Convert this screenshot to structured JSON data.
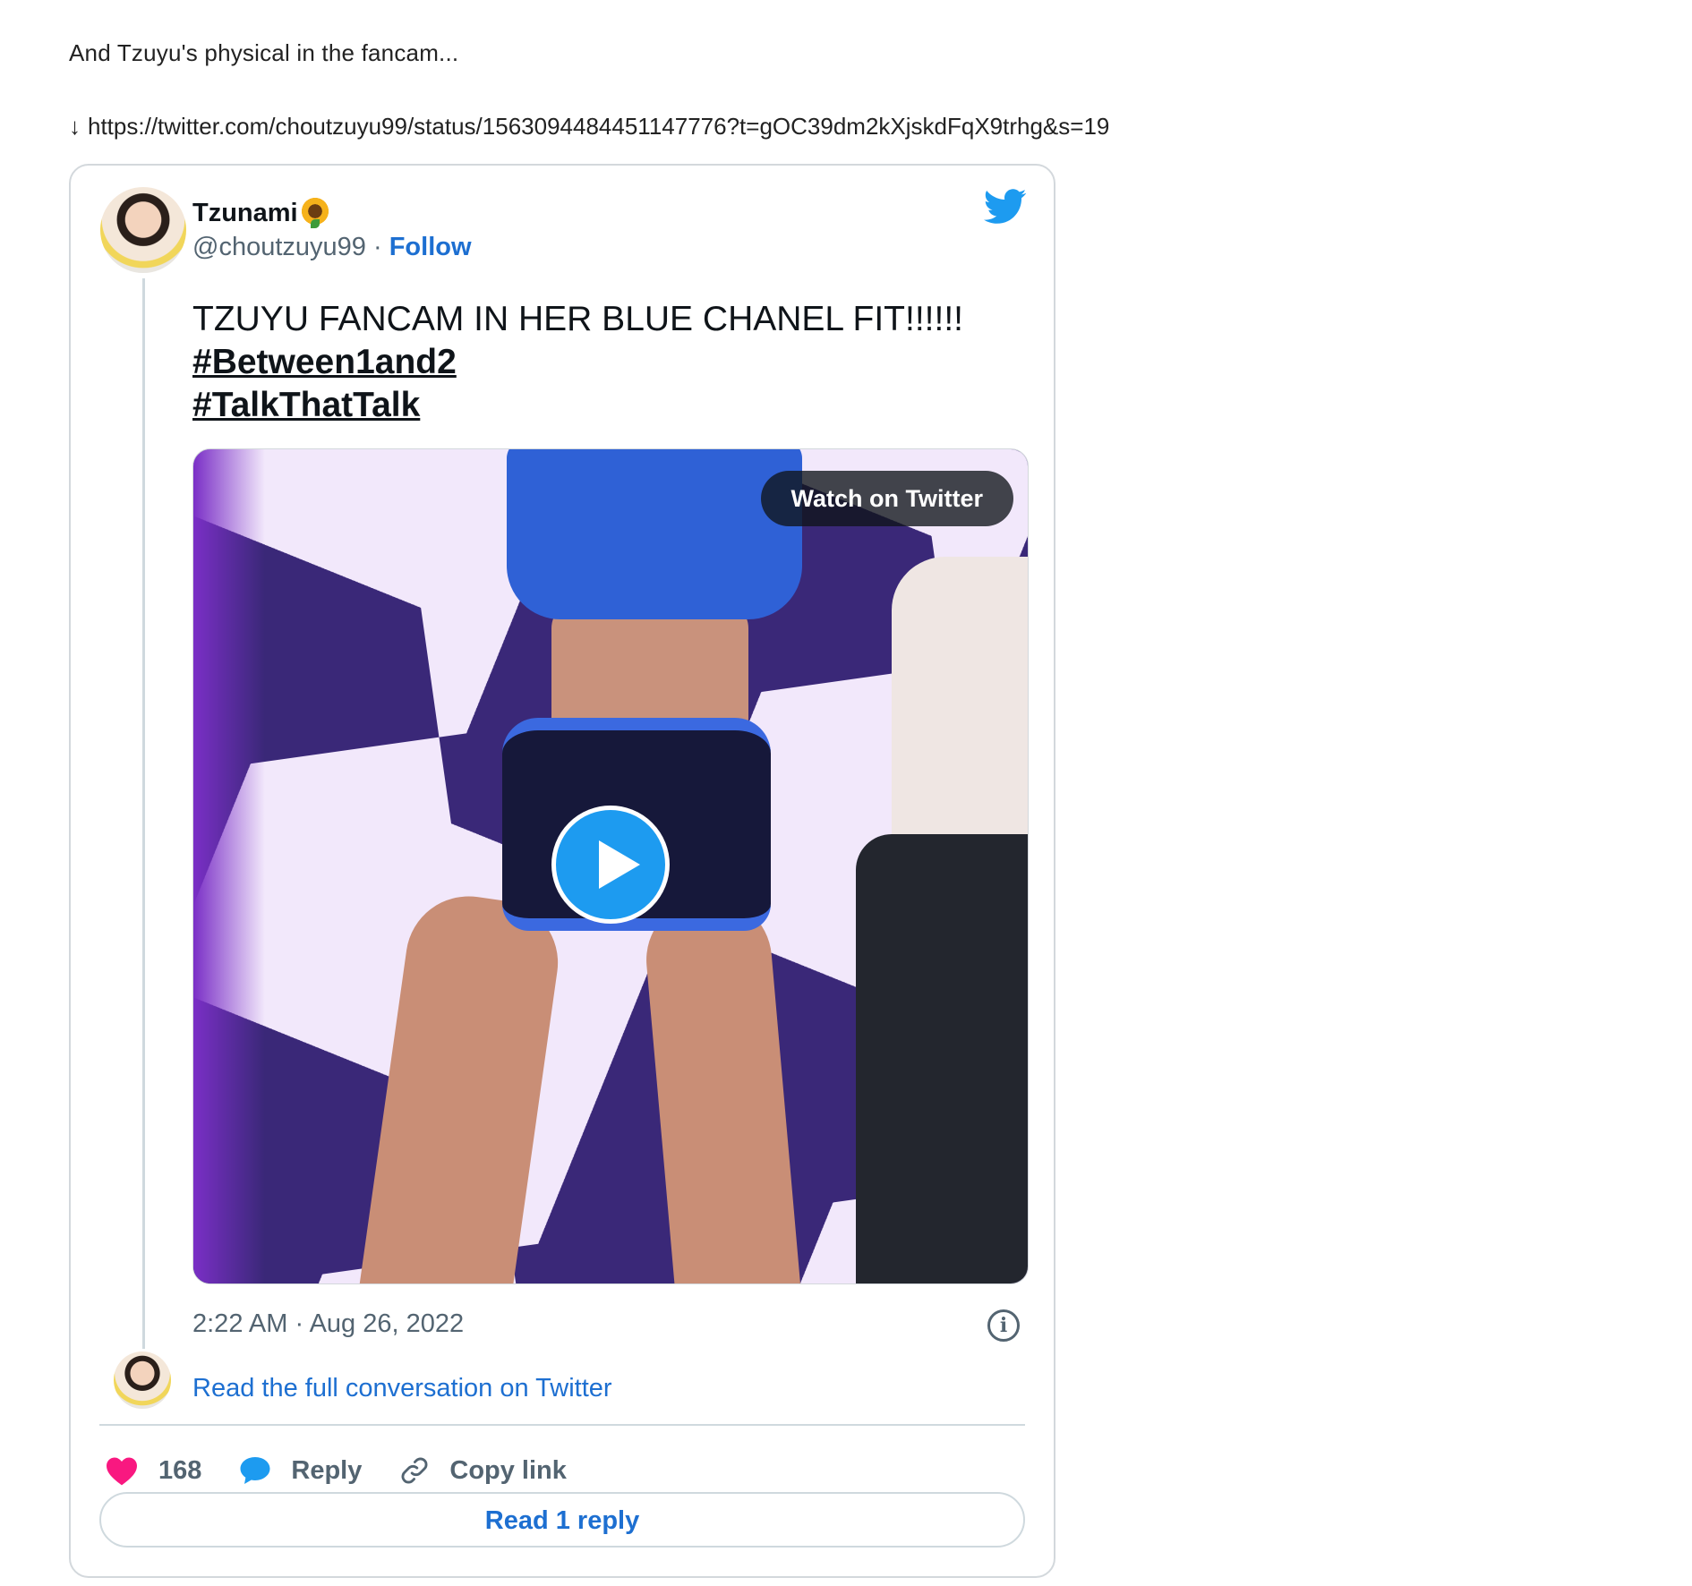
{
  "post": {
    "text": "And Tzuyu's physical in the fancam...",
    "link_arrow": "↓",
    "link_url": "https://twitter.com/choutzuyu99/status/1563094484451147776?t=gOC39dm2kXjskdFqX9trhg&s=19"
  },
  "tweet": {
    "author_name": "Tzunami",
    "author_emoji_icon": "sunflower-icon",
    "author_handle": "@choutzuyu99",
    "separator": "·",
    "follow_label": "Follow",
    "text": "TZUYU FANCAM IN HER BLUE CHANEL FIT!!!!!!",
    "hashtags": [
      "#Between1and2",
      "#TalkThatTalk"
    ],
    "watch_label": "Watch on Twitter",
    "timestamp": "2:22 AM · Aug 26, 2022",
    "read_conversation_label": "Read the full conversation on Twitter",
    "like_count": "168",
    "reply_label": "Reply",
    "copy_link_label": "Copy link",
    "read_reply_label": "Read 1 reply",
    "info_icon_glyph": "i"
  },
  "colors": {
    "link_blue": "#1d6fd1",
    "twitter_blue": "#1d9bf0",
    "heart_pink": "#f91880",
    "muted_gray": "#536471"
  }
}
